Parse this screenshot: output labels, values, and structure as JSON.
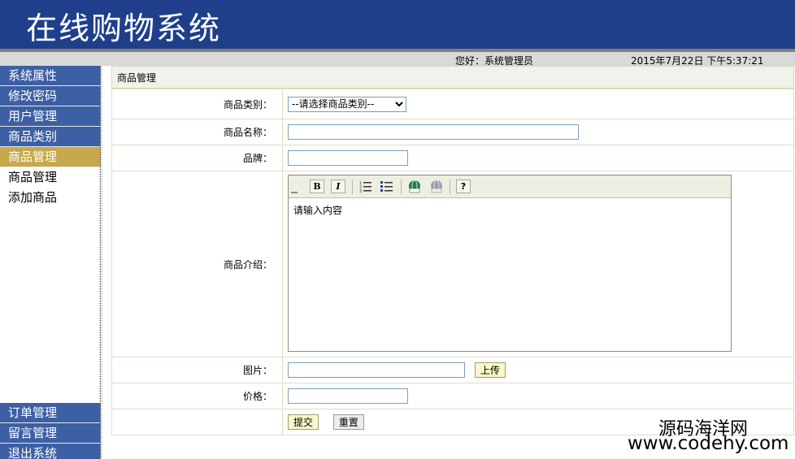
{
  "header": {
    "title": "在线购物系统"
  },
  "infobar": {
    "greeting": "您好：系统管理员",
    "datetime": "2015年7月22日 下午5:37:21"
  },
  "sidebar": {
    "top_items": [
      {
        "label": "系统属性"
      },
      {
        "label": "修改密码"
      },
      {
        "label": "用户管理"
      },
      {
        "label": "商品类别"
      },
      {
        "label": "商品管理",
        "active": true
      }
    ],
    "sub_items": [
      {
        "label": "商品管理"
      },
      {
        "label": "添加商品"
      }
    ],
    "bottom_items": [
      {
        "label": "订单管理"
      },
      {
        "label": "留言管理"
      },
      {
        "label": "退出系统"
      }
    ]
  },
  "panel": {
    "title": "商品管理",
    "form": {
      "category_label": "商品类别：",
      "category_selected": "--请选择商品类别--",
      "name_label": "商品名称：",
      "brand_label": "品牌：",
      "intro_label": "商品介绍：",
      "editor_placeholder": "请输入内容",
      "image_label": "图片：",
      "upload_label": "上传",
      "price_label": "价格：",
      "submit_label": "提交",
      "reset_label": "重置"
    },
    "editor_tools": [
      "bold-icon",
      "italic-icon",
      "ordered-list-icon",
      "unordered-list-icon",
      "link-icon",
      "unlink-icon",
      "help-icon"
    ]
  },
  "watermark": {
    "line1": "源码海洋网",
    "line2": "www.codehy.com"
  }
}
